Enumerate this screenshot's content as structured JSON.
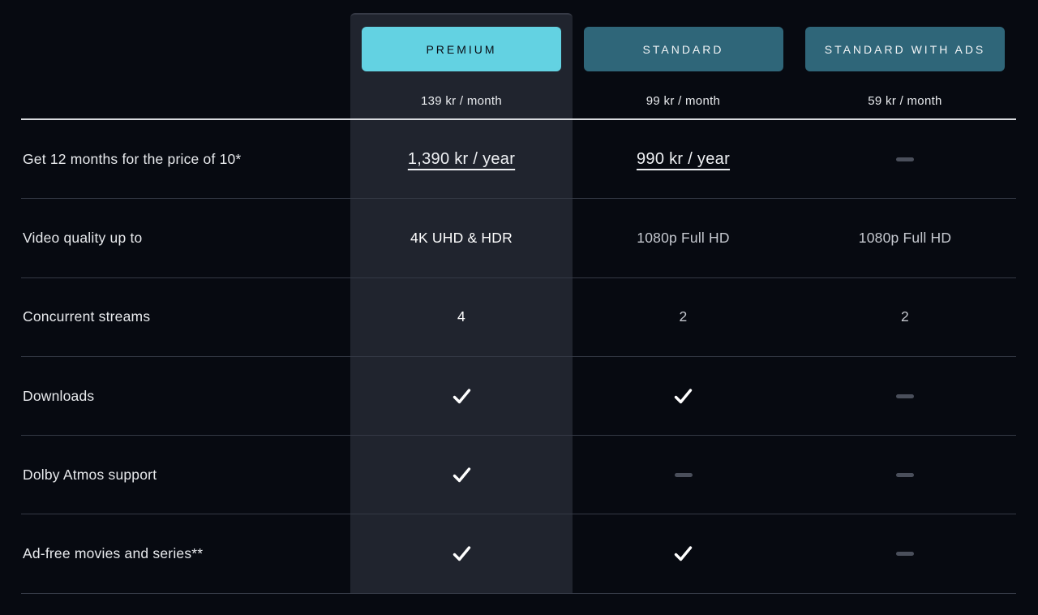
{
  "colors": {
    "background": "#070a11",
    "premium_panel": "#20242e",
    "accent_cyan": "#63d2e2",
    "teal_button": "#2f6679",
    "header_divider": "#d9dbdf",
    "row_divider": "#343945",
    "dash": "#4a4f5b",
    "check": "#ffffff"
  },
  "plans": [
    {
      "name": "PREMIUM",
      "price": "139 kr / month",
      "highlight": true
    },
    {
      "name": "STANDARD",
      "price": "99 kr / month",
      "highlight": false
    },
    {
      "name": "STANDARD WITH ADS",
      "price": "59 kr / month",
      "highlight": false
    }
  ],
  "rows": [
    {
      "label": "Get 12 months for the price of 10*",
      "values": [
        {
          "type": "link",
          "text": "1,390 kr / year"
        },
        {
          "type": "link",
          "text": "990 kr / year"
        },
        {
          "type": "dash"
        }
      ]
    },
    {
      "label": "Video quality up to",
      "values": [
        {
          "type": "text",
          "text": "4K UHD & HDR"
        },
        {
          "type": "text",
          "text": "1080p Full HD"
        },
        {
          "type": "text",
          "text": "1080p Full HD"
        }
      ]
    },
    {
      "label": "Concurrent streams",
      "values": [
        {
          "type": "text",
          "text": "4"
        },
        {
          "type": "text",
          "text": "2"
        },
        {
          "type": "text",
          "text": "2"
        }
      ]
    },
    {
      "label": "Downloads",
      "values": [
        {
          "type": "check"
        },
        {
          "type": "check"
        },
        {
          "type": "dash"
        }
      ]
    },
    {
      "label": "Dolby Atmos support",
      "values": [
        {
          "type": "check"
        },
        {
          "type": "dash"
        },
        {
          "type": "dash"
        }
      ]
    },
    {
      "label": "Ad-free movies and series**",
      "values": [
        {
          "type": "check"
        },
        {
          "type": "check"
        },
        {
          "type": "dash"
        }
      ]
    }
  ]
}
